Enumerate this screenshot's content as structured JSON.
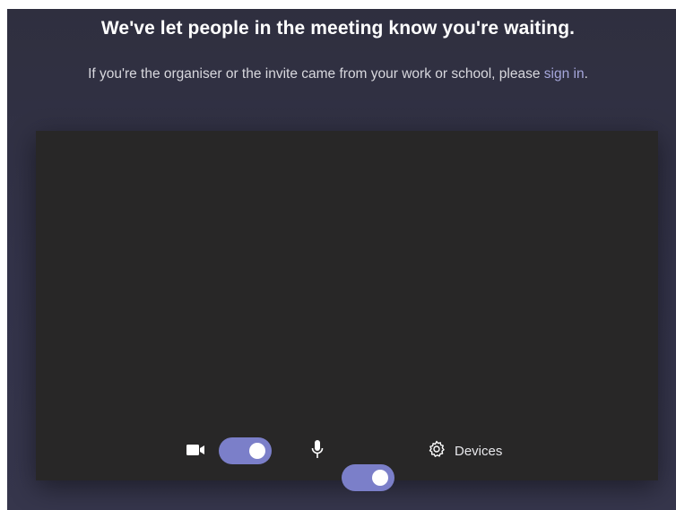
{
  "prejoin": {
    "heading": "We've let people in the meeting know you're waiting.",
    "subtext_before": "If you're the organiser or the invite came from your work or school, please ",
    "sign_in_link": "sign in",
    "subtext_after": "."
  },
  "controls": {
    "camera": {
      "icon": "camera-icon",
      "on": true
    },
    "microphone": {
      "icon": "microphone-icon",
      "on": true
    },
    "devices": {
      "icon": "gear-icon",
      "label": "Devices"
    }
  },
  "colors": {
    "background": "#33334a",
    "video_preview": "#282727",
    "toggle_on": "#7b7fc9",
    "link": "#a6a7dc",
    "heading_text": "#ffffff",
    "body_text": "#d8d8de"
  }
}
